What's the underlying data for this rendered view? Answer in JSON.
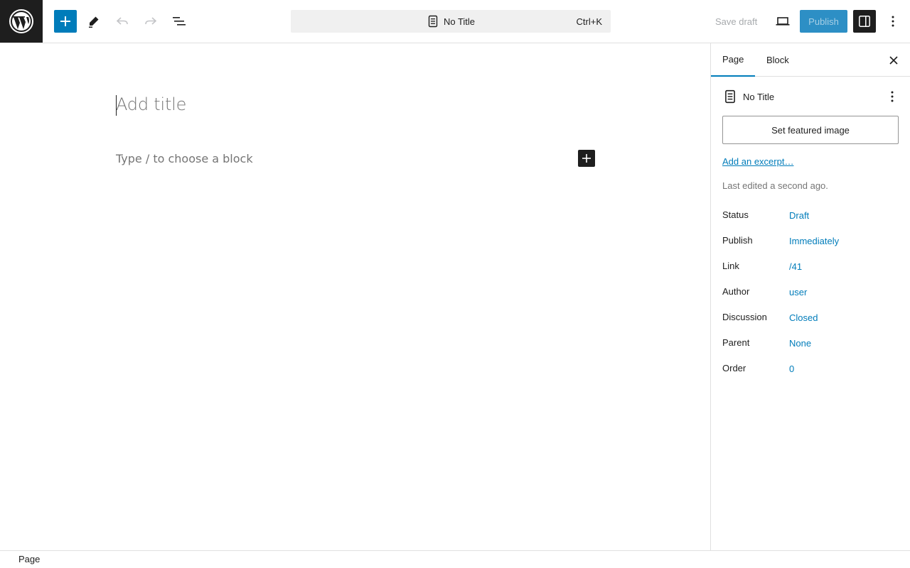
{
  "topbar": {
    "logo_icon": "wordpress-logo-icon",
    "inserter_icon": "plus-icon",
    "tools_icon": "pencil-icon",
    "undo_icon": "undo-icon",
    "redo_icon": "redo-icon",
    "list_view_icon": "list-view-icon",
    "command_bar": {
      "title": "No Title",
      "shortcut": "Ctrl+K",
      "icon": "page-icon"
    },
    "save_draft_label": "Save draft",
    "preview_icon": "desktop-icon",
    "publish_label": "Publish",
    "settings_icon": "sidebar-toggle-icon",
    "options_icon": "more-vertical-icon",
    "accent_color": "#007cba"
  },
  "editor": {
    "title_placeholder": "Add title",
    "block_placeholder": "Type / to choose a block",
    "block_inserter_icon": "plus-icon"
  },
  "sidebar": {
    "tabs": [
      {
        "label": "Page",
        "active": true
      },
      {
        "label": "Block",
        "active": false
      }
    ],
    "close_icon": "close-icon",
    "post_card": {
      "title": "No Title",
      "icon": "page-icon",
      "menu_icon": "more-vertical-icon"
    },
    "featured_image_label": "Set featured image",
    "excerpt_link": "Add an excerpt…",
    "last_edited": "Last edited a second ago.",
    "meta": [
      {
        "label": "Status",
        "value": "Draft"
      },
      {
        "label": "Publish",
        "value": "Immediately"
      },
      {
        "label": "Link",
        "value": "/41"
      },
      {
        "label": "Author",
        "value": "user"
      },
      {
        "label": "Discussion",
        "value": "Closed"
      },
      {
        "label": "Parent",
        "value": "None"
      },
      {
        "label": "Order",
        "value": "0"
      }
    ]
  },
  "footer": {
    "breadcrumb": "Page"
  }
}
